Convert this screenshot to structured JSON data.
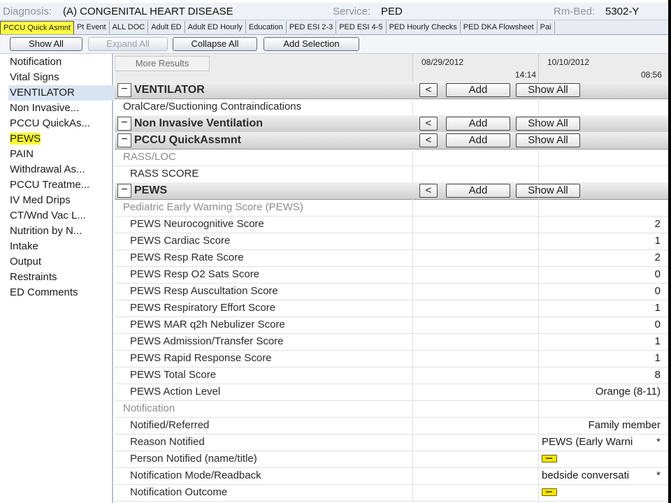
{
  "header": {
    "diagnosis_label": "Diagnosis:",
    "diagnosis_value": "(A) CONGENITAL HEART DISEASE",
    "service_label": "Service:",
    "service_value": "PED",
    "rmbed_label": "Rm-Bed:",
    "rmbed_value": "5302-Y"
  },
  "tabs": [
    {
      "label": "PCCU Quick Asmnt",
      "active": true
    },
    {
      "label": "Pt Event"
    },
    {
      "label": "ALL DOC"
    },
    {
      "label": "Adult ED"
    },
    {
      "label": "Adult ED Hourly"
    },
    {
      "label": "Education"
    },
    {
      "label": "PED ESI 2-3"
    },
    {
      "label": "PED ESI 4-5"
    },
    {
      "label": "PED Hourly Checks"
    },
    {
      "label": "PED DKA Flowsheet"
    },
    {
      "label": "Pai"
    }
  ],
  "toolbar": {
    "show_all": "Show All",
    "expand_all": "Expand All",
    "collapse_all": "Collapse All",
    "add_selection": "Add Selection"
  },
  "sidebar": {
    "items": [
      {
        "label": "Notification"
      },
      {
        "label": "Vital Signs"
      },
      {
        "label": "VENTILATOR",
        "selected": true
      },
      {
        "label": "Non Invasive..."
      },
      {
        "label": "PCCU QuickAs..."
      },
      {
        "label": "PEWS",
        "highlight": true
      },
      {
        "label": "PAIN"
      },
      {
        "label": "Withdrawal As..."
      },
      {
        "label": "PCCU Treatme..."
      },
      {
        "label": "IV Med Drips"
      },
      {
        "label": "CT/Wnd Vac L..."
      },
      {
        "label": "Nutrition by N..."
      },
      {
        "label": "Intake"
      },
      {
        "label": "Output"
      },
      {
        "label": "Restraints"
      },
      {
        "label": "ED Comments"
      }
    ]
  },
  "grid": {
    "more_results": "More Results",
    "columns": [
      {
        "date": "08/29/2012",
        "time": "14:14"
      },
      {
        "date": "10/10/2012",
        "time": "08:56"
      }
    ],
    "section_buttons": {
      "prev": "<",
      "add": "Add",
      "show_all": "Show All"
    },
    "toggle_symbol": "−",
    "rows": [
      {
        "kind": "section",
        "label": "VENTILATOR"
      },
      {
        "kind": "item",
        "label": "OralCare/Suctioning Contraindications",
        "indent": 0
      },
      {
        "kind": "section",
        "label": "Non Invasive Ventilation"
      },
      {
        "kind": "section",
        "label": "PCCU QuickAssmnt"
      },
      {
        "kind": "sub",
        "label": "RASS/LOC"
      },
      {
        "kind": "item",
        "label": "RASS SCORE"
      },
      {
        "kind": "section",
        "label": "PEWS"
      },
      {
        "kind": "sub",
        "label": "Pediatric Early Warning Score (PEWS)"
      },
      {
        "kind": "item",
        "label": "PEWS Neurocognitive Score",
        "v2": "2"
      },
      {
        "kind": "item",
        "label": "PEWS Cardiac Score",
        "v2": "1"
      },
      {
        "kind": "item",
        "label": "PEWS Resp Rate Score",
        "v2": "2"
      },
      {
        "kind": "item",
        "label": "PEWS Resp O2 Sats Score",
        "v2": "0"
      },
      {
        "kind": "item",
        "label": "PEWS Resp Auscultation Score",
        "v2": "0"
      },
      {
        "kind": "item",
        "label": "PEWS Respiratory Effort Score",
        "v2": "1"
      },
      {
        "kind": "item",
        "label": "PEWS MAR q2h Nebulizer Score",
        "v2": "0"
      },
      {
        "kind": "item",
        "label": "PEWS Admission/Transfer Score",
        "v2": "1"
      },
      {
        "kind": "item",
        "label": "PEWS Rapid Response Score",
        "v2": "1"
      },
      {
        "kind": "item",
        "label": "PEWS Total Score",
        "v2": "8"
      },
      {
        "kind": "item",
        "label": "PEWS Action Level",
        "v2": "Orange (8-11)"
      },
      {
        "kind": "sub",
        "label": "Notification"
      },
      {
        "kind": "item",
        "label": "Notified/Referred",
        "v2": "Family member"
      },
      {
        "kind": "item",
        "label": "Reason Notified",
        "v2": "PEWS (Early Warni",
        "v2_left": true,
        "star": "*"
      },
      {
        "kind": "item",
        "label": "Person Notified (name/title)",
        "v2_icon": "note-icon"
      },
      {
        "kind": "item",
        "label": "Notification Mode/Readback",
        "v2": "bedside conversati",
        "v2_left": true,
        "star": "*"
      },
      {
        "kind": "item",
        "label": "Notification Outcome",
        "v2_icon": "note-icon"
      }
    ]
  }
}
